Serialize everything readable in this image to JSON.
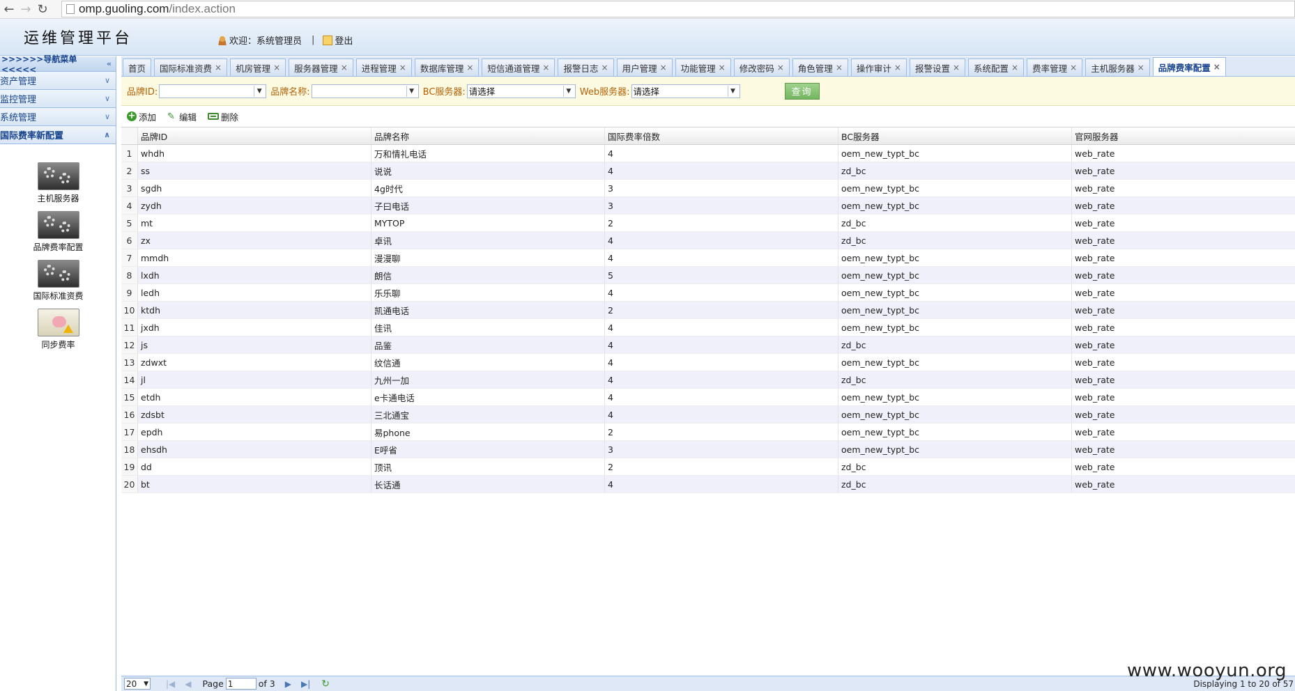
{
  "browser": {
    "url_host": "omp.guoling.com",
    "url_path": "/index.action"
  },
  "header": {
    "title": "运维管理平台",
    "welcome": "欢迎：系统管理员",
    "separator": "|",
    "logout": "登出"
  },
  "leftnav": {
    "title": ">>>>>>导航菜单<<<<<",
    "sections": [
      {
        "label": "资产管理"
      },
      {
        "label": "监控管理"
      },
      {
        "label": "系统管理"
      },
      {
        "label": "国际费率新配置"
      }
    ],
    "apps": [
      {
        "label": "主机服务器"
      },
      {
        "label": "品牌费率配置"
      },
      {
        "label": "国际标准资费"
      },
      {
        "label": "同步费率"
      }
    ]
  },
  "tabs": [
    {
      "label": "首页",
      "closable": false
    },
    {
      "label": "国际标准资费",
      "closable": true
    },
    {
      "label": "机房管理",
      "closable": true
    },
    {
      "label": "服务器管理",
      "closable": true
    },
    {
      "label": "进程管理",
      "closable": true
    },
    {
      "label": "数据库管理",
      "closable": true
    },
    {
      "label": "短信通道管理",
      "closable": true
    },
    {
      "label": "报警日志",
      "closable": true
    },
    {
      "label": "用户管理",
      "closable": true
    },
    {
      "label": "功能管理",
      "closable": true
    },
    {
      "label": "修改密码",
      "closable": true
    },
    {
      "label": "角色管理",
      "closable": true
    },
    {
      "label": "操作审计",
      "closable": true
    },
    {
      "label": "报警设置",
      "closable": true
    },
    {
      "label": "系统配置",
      "closable": true
    },
    {
      "label": "费率管理",
      "closable": true
    },
    {
      "label": "主机服务器",
      "closable": true
    },
    {
      "label": "品牌费率配置",
      "closable": true,
      "active": true
    }
  ],
  "search": {
    "brand_id_label": "品牌ID:",
    "brand_id_value": "",
    "brand_name_label": "品牌名称:",
    "brand_name_value": "",
    "bc_label": "BC服务器:",
    "bc_value": "请选择",
    "web_label": "Web服务器:",
    "web_value": "请选择",
    "query_button": "查询"
  },
  "toolbar": {
    "add": "添加",
    "edit": "编辑",
    "delete": "删除"
  },
  "table": {
    "columns": [
      "品牌ID",
      "品牌名称",
      "国际费率倍数",
      "BC服务器",
      "官网服务器"
    ],
    "rows": [
      [
        "1",
        "whdh",
        "万和情礼电话",
        "4",
        "oem_new_typt_bc",
        "web_rate"
      ],
      [
        "2",
        "ss",
        "说说",
        "4",
        "zd_bc",
        "web_rate"
      ],
      [
        "3",
        "sgdh",
        "4g时代",
        "3",
        "oem_new_typt_bc",
        "web_rate"
      ],
      [
        "4",
        "zydh",
        "子曰电话",
        "3",
        "oem_new_typt_bc",
        "web_rate"
      ],
      [
        "5",
        "mt",
        "MYTOP",
        "2",
        "zd_bc",
        "web_rate"
      ],
      [
        "6",
        "zx",
        "卓讯",
        "4",
        "zd_bc",
        "web_rate"
      ],
      [
        "7",
        "mmdh",
        "漫漫聊",
        "4",
        "oem_new_typt_bc",
        "web_rate"
      ],
      [
        "8",
        "lxdh",
        "朗信",
        "5",
        "oem_new_typt_bc",
        "web_rate"
      ],
      [
        "9",
        "ledh",
        "乐乐聊",
        "4",
        "oem_new_typt_bc",
        "web_rate"
      ],
      [
        "10",
        "ktdh",
        "凯通电话",
        "2",
        "oem_new_typt_bc",
        "web_rate"
      ],
      [
        "11",
        "jxdh",
        "佳讯",
        "4",
        "oem_new_typt_bc",
        "web_rate"
      ],
      [
        "12",
        "js",
        "品鉴",
        "4",
        "zd_bc",
        "web_rate"
      ],
      [
        "13",
        "zdwxt",
        "纹信通",
        "4",
        "oem_new_typt_bc",
        "web_rate"
      ],
      [
        "14",
        "jl",
        "九州一加",
        "4",
        "zd_bc",
        "web_rate"
      ],
      [
        "15",
        "etdh",
        "e卡通电话",
        "4",
        "oem_new_typt_bc",
        "web_rate"
      ],
      [
        "16",
        "zdsbt",
        "三北通宝",
        "4",
        "oem_new_typt_bc",
        "web_rate"
      ],
      [
        "17",
        "epdh",
        "易phone",
        "2",
        "oem_new_typt_bc",
        "web_rate"
      ],
      [
        "18",
        "ehsdh",
        "E呼省",
        "3",
        "oem_new_typt_bc",
        "web_rate"
      ],
      [
        "19",
        "dd",
        "顶讯",
        "2",
        "zd_bc",
        "web_rate"
      ],
      [
        "20",
        "bt",
        "长话通",
        "4",
        "zd_bc",
        "web_rate"
      ]
    ]
  },
  "pager": {
    "page_size": "20",
    "page_label": "Page",
    "page_value": "1",
    "of_label": "of 3",
    "display": "Displaying 1 to 20 of 57"
  },
  "watermark": "www.wooyun.org"
}
